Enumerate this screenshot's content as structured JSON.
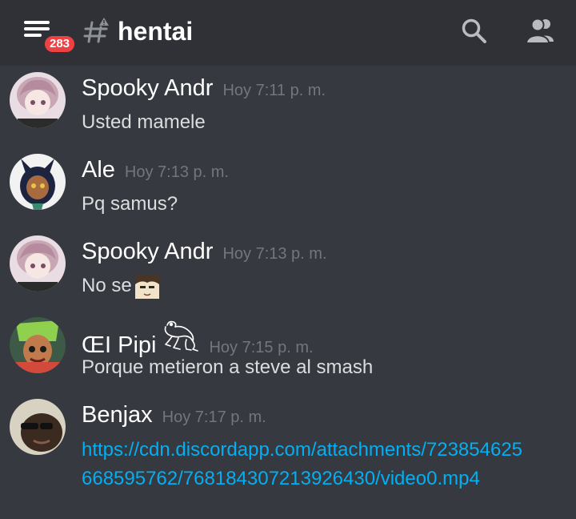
{
  "header": {
    "unread_count": "283",
    "channel_name": "hentai",
    "icons": [
      "menu-icon",
      "hash-icon",
      "search-icon",
      "members-icon"
    ]
  },
  "messages": [
    {
      "username": "Spooky Andr",
      "timestamp": "Hoy 7:11 p. m.",
      "text": "Usted mamele"
    },
    {
      "username": "Ale",
      "timestamp": "Hoy 7:13 p. m.",
      "text": "Pq samus?"
    },
    {
      "username": "Spooky Andr",
      "timestamp": "Hoy 7:13 p. m.",
      "text": "No se"
    },
    {
      "username": "ŒI Pipi",
      "timestamp": "Hoy 7:15 p. m.",
      "text": "Porque metieron a steve al smash"
    },
    {
      "username": "Benjax",
      "timestamp": "Hoy 7:17 p. m.",
      "text": "https://cdn.discordapp.com/attachments/723854625668595762/768184307213926430/video0.mp4"
    }
  ],
  "colors": {
    "background": "#36393f",
    "header_background": "#2f3136",
    "badge": "#ed4245",
    "link": "#00b0f4",
    "timestamp": "#72767d"
  }
}
